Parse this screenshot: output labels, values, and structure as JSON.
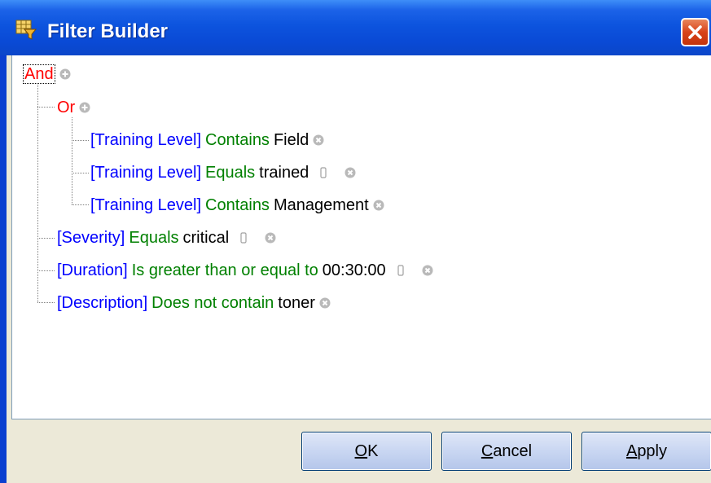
{
  "window": {
    "title": "Filter Builder"
  },
  "tree": {
    "root": {
      "label": "And"
    },
    "or_group": {
      "label": "Or",
      "conditions": [
        {
          "field": "[Training Level]",
          "operator": "Contains",
          "value": "Field"
        },
        {
          "field": "[Training Level]",
          "operator": "Equals",
          "value": "trained"
        },
        {
          "field": "[Training Level]",
          "operator": "Contains",
          "value": "Management"
        }
      ]
    },
    "conditions": [
      {
        "field": "[Severity]",
        "operator": "Equals",
        "value": "critical"
      },
      {
        "field": "[Duration]",
        "operator": "Is greater than or equal to",
        "value": "00:30:00"
      },
      {
        "field": "[Description]",
        "operator": "Does not contain",
        "value": "toner"
      }
    ]
  },
  "buttons": {
    "ok": {
      "accel": "O",
      "rest": "K"
    },
    "cancel": {
      "accel": "C",
      "rest": "ancel"
    },
    "apply": {
      "accel": "A",
      "rest": "pply"
    }
  },
  "colors": {
    "group": "#ff0000",
    "field": "#0000ff",
    "operator": "#008000",
    "value": "#000000",
    "titlebar": "#0a4ad6"
  },
  "icons": [
    "filter-builder-icon",
    "close-icon",
    "add-icon",
    "remove-icon",
    "value-editor-icon"
  ]
}
